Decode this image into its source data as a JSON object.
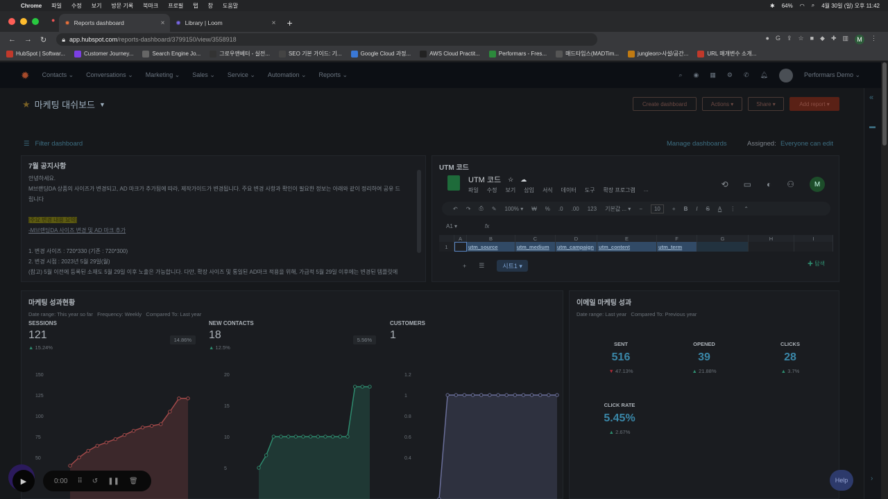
{
  "macos_menu": {
    "app": "Chrome",
    "items": [
      "파일",
      "수정",
      "보기",
      "방문 기록",
      "북마크",
      "프로필",
      "탭",
      "창",
      "도움말"
    ],
    "battery": "64%",
    "datetime": "4월 30일 (일) 오후 11:42"
  },
  "browser": {
    "tabs": [
      {
        "title": "Reports dashboard",
        "active": true
      },
      {
        "title": "Library | Loom",
        "active": false
      }
    ],
    "url_host": "app.hubspot.com",
    "url_path": "/reports-dashboard/3799150/view/3558918",
    "profile_initial": "M",
    "bookmarks": [
      {
        "label": "HubSpot | Softwar...",
        "color": "#c0392b"
      },
      {
        "label": "Customer Journey...",
        "color": "#7b3fe4"
      },
      {
        "label": "Search Engine Jo...",
        "color": "#555"
      },
      {
        "label": "그로우앤베터 - 실전...",
        "color": "#333"
      },
      {
        "label": "SEO 기본 가이드: 기...",
        "color": "#444"
      },
      {
        "label": "Google Cloud 과정...",
        "color": "#3a78d6"
      },
      {
        "label": "AWS Cloud Practit...",
        "color": "#222"
      },
      {
        "label": "Performars - Fres...",
        "color": "#2c8a3c"
      },
      {
        "label": "매드타임스(MADTim...",
        "color": "#555"
      },
      {
        "label": "jungleon>사설/공간...",
        "color": "#c07a12"
      },
      {
        "label": "URL 매개변수 소개...",
        "color": "#c0392b"
      }
    ]
  },
  "hubspot_nav": {
    "items": [
      "Contacts",
      "Conversations",
      "Marketing",
      "Sales",
      "Service",
      "Automation",
      "Reports"
    ],
    "account": "Performars Demo"
  },
  "dashboard": {
    "title": "마케팅 대쉬보드",
    "buttons": {
      "create": "Create dashboard",
      "actions": "Actions",
      "share": "Share",
      "add_report": "Add report"
    },
    "filter": "Filter dashboard",
    "manage": "Manage dashboards",
    "assigned_label": "Assigned:",
    "assigned_value": "Everyone can edit"
  },
  "notice": {
    "title": "7월 공지사항",
    "lines": [
      "안녕하세요.",
      "M브랜딩DA 상품의 사이즈가 변경되고, AD 마크가 추가됨에 따라, 제작가이드가 변경됩니다. 주요 변경 사항과 확인이 필요한 정보는 아래와 같이 정리하여 공유 드",
      "립니다"
    ],
    "highlight": "[주요 변경 내용 요약]",
    "link": "-M브랜딩DA 사이즈 변경 및 AD 마크 추가",
    "list": [
      "1. 변경 사이즈 : 720*330 (기존 : 720*300)",
      "2. 변경 시점 : 2023년 5월 29일(월)",
      "(참고) 5월 이전에 등록된 소재도 5월 29일 이후 노출은 가능합니다. 다만, 확장 사이즈 및 통일된 AD마크 적용을 위해, 가급적 5월 29일 이후에는 변경된 템플릿에"
    ]
  },
  "utm": {
    "card_title": "UTM 코드",
    "sheet_title": "UTM 코드",
    "menu": [
      "파일",
      "수정",
      "보기",
      "삽입",
      "서식",
      "데이터",
      "도구",
      "확장 프로그램",
      "..."
    ],
    "toolbar": {
      "zoom": "100%",
      "currency": "₩",
      "percent": "%",
      "dec1": ".0",
      "dec2": ".00",
      "num": "123",
      "font": "기본값 ...",
      "size": "10"
    },
    "name_box": "A1",
    "fx": "fx",
    "columns": [
      "A",
      "B",
      "C",
      "D",
      "E",
      "F",
      "G",
      "H",
      "I"
    ],
    "row_num": "1",
    "cells": [
      "utm_source",
      "utm_medium",
      "utm_campaign",
      "utm_content",
      "utm_term",
      "",
      ""
    ],
    "sheet_tab": "시트1",
    "explore": "탐색",
    "avatar": "M"
  },
  "marketing": {
    "title": "마케팅 성과현황",
    "date_range": "Date range: This year so far",
    "frequency": "Frequency: Weekly",
    "compared": "Compared To: Last year",
    "kpis": [
      {
        "label": "SESSIONS",
        "value": "121",
        "change": "15.24%",
        "badge": "14.86%"
      },
      {
        "label": "NEW CONTACTS",
        "value": "18",
        "change": "12.5%",
        "badge": "5.56%"
      },
      {
        "label": "CUSTOMERS",
        "value": "1",
        "change": "",
        "badge": ""
      }
    ]
  },
  "chart_data": [
    {
      "type": "area",
      "title": "",
      "ylim": [
        0,
        150
      ],
      "yticks": [
        50,
        75,
        100,
        125,
        150
      ],
      "color": "#a54a4a",
      "values": [
        40,
        50,
        58,
        64,
        68,
        72,
        77,
        82,
        86,
        88,
        90,
        105,
        121,
        121
      ]
    },
    {
      "type": "area",
      "title": "",
      "ylim": [
        0,
        20
      ],
      "yticks": [
        5,
        10,
        15,
        20
      ],
      "color": "#2e8b6e",
      "values": [
        5,
        7,
        10,
        10,
        10,
        10,
        10,
        10,
        10,
        10,
        10,
        10,
        10,
        18,
        18,
        18
      ]
    },
    {
      "type": "area",
      "title": "",
      "ylim": [
        0,
        1.2
      ],
      "yticks": [
        0.4,
        0.6,
        0.8,
        1,
        1.2
      ],
      "color": "#6a6f9a",
      "values": [
        0,
        1,
        1,
        1,
        1,
        1,
        1,
        1,
        1,
        1,
        1,
        1,
        1,
        1,
        1
      ]
    }
  ],
  "email": {
    "title": "이메일 마케팅 성과",
    "date_range": "Date range: Last year",
    "compared": "Compared To: Previous year",
    "stats": [
      {
        "label": "SENT",
        "value": "516",
        "change": "47.13%",
        "dir": "down"
      },
      {
        "label": "OPENED",
        "value": "39",
        "change": "21.88%",
        "dir": "up"
      },
      {
        "label": "CLICKS",
        "value": "28",
        "change": "3.7%",
        "dir": "up"
      },
      {
        "label": "CLICK RATE",
        "value": "5.45%",
        "change": "2.67%",
        "dir": "up"
      }
    ]
  },
  "loom": {
    "timer": "0:00"
  },
  "help": "Help"
}
